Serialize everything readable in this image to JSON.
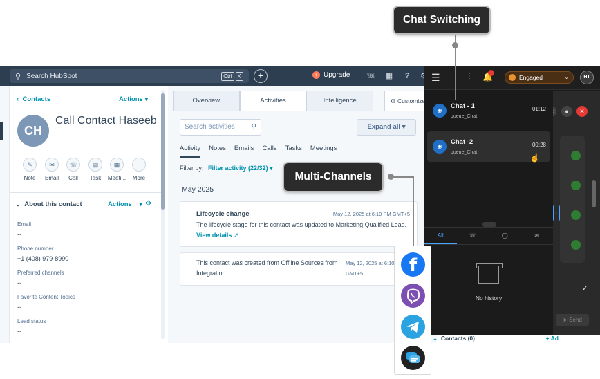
{
  "topbar": {
    "search_placeholder": "Search HubSpot",
    "kbd": [
      "Ctrl",
      "K"
    ],
    "plus": "+",
    "upgrade_label": "Upgrade"
  },
  "left": {
    "back_label": "Contacts",
    "actions_label": "Actions",
    "avatar_initials": "CH",
    "contact_name": "Call Contact Haseeb",
    "quick_actions": [
      "Note",
      "Email",
      "Call",
      "Task",
      "Meeti...",
      "More"
    ],
    "about_title": "About this contact",
    "about_actions": "Actions",
    "properties": [
      {
        "label": "Email",
        "value": "--"
      },
      {
        "label": "Phone number",
        "value": "+1 (408) 979-8990"
      },
      {
        "label": "Preferred channels",
        "value": "--"
      },
      {
        "label": "Favorite Content Topics",
        "value": "--"
      },
      {
        "label": "Lead status",
        "value": "--"
      }
    ]
  },
  "center": {
    "tabs": [
      "Overview",
      "Activities",
      "Intelligence"
    ],
    "active_tab": "Activities",
    "customize_label": "Customize",
    "search_placeholder": "Search activities",
    "expand_label": "Expand all",
    "subtabs": [
      "Activity",
      "Notes",
      "Emails",
      "Calls",
      "Tasks",
      "Meetings"
    ],
    "filter_prefix": "Filter by:",
    "filter_value": "Filter activity (22/32)",
    "month": "May 2025",
    "cards": [
      {
        "title": "Lifecycle change",
        "date": "May 12, 2025 at 6:10 PM GMT+5",
        "body": "The lifecycle stage for this contact was updated to Marketing Qualified Lead.",
        "link": "View details"
      },
      {
        "title": "",
        "date_line1": "May 12, 2025 at 6:10 PM",
        "date_line2": "GMT+5",
        "body": "This contact was created from Offline Sources from Integration"
      }
    ]
  },
  "right_panel": {
    "notification_count": "1",
    "status": "Engaged",
    "user_initials": "HT",
    "chats": [
      {
        "name": "Chat - 1",
        "queue": "queue_Chat",
        "time": "01:12"
      },
      {
        "name": "Chat -2",
        "queue": "queue_Chat",
        "time": "00:28"
      }
    ],
    "bottom_tabs": [
      "All",
      "phone",
      "chat",
      "email"
    ],
    "empty_label": "No history",
    "send_label": "Send",
    "contacts_row": "Contacts (0)",
    "add_label": "+ Ad"
  },
  "callouts": {
    "chat_switching": "Chat Switching",
    "multi_channels": "Multi-Channels"
  },
  "channels": [
    {
      "icon": "facebook-icon",
      "color": "#1877f2"
    },
    {
      "icon": "viber-icon",
      "color": "#7d4fb3"
    },
    {
      "icon": "telegram-icon",
      "color": "#2aa3e0"
    },
    {
      "icon": "chat-bubbles-icon",
      "color": "#222222"
    }
  ]
}
